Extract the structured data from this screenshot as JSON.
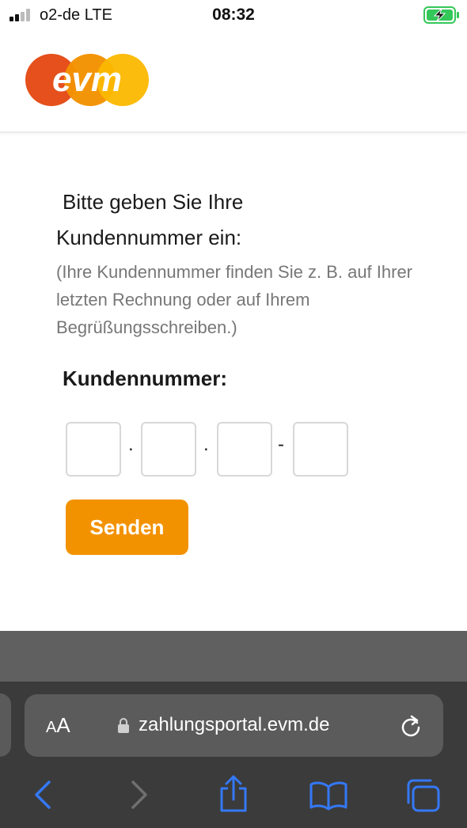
{
  "status_bar": {
    "carrier": "o2-de  LTE",
    "time": "08:32",
    "signal_bars_active": 2,
    "signal_bars_total": 4,
    "battery_color": "#34c759"
  },
  "header": {
    "logo_text": "evm",
    "logo_colors": [
      "#e5501c",
      "#f39200",
      "#fbb800"
    ]
  },
  "content": {
    "intro_line1": "Bitte geben Sie Ihre",
    "intro_line2": "Kundennummer ein:",
    "hint": "(Ihre Kundennummer finden Sie z. B. auf Ihrer letzten Rechnung oder auf Ihrem Begrüßungsschreiben.)",
    "field_label": "Kundennummer:",
    "digit_boxes": [
      "",
      "",
      "",
      ""
    ],
    "separators": [
      ".",
      ".",
      "-"
    ],
    "send_label": "Senden",
    "accent_color": "#f39200"
  },
  "browser": {
    "aa_label_small": "A",
    "aa_label_large": "A",
    "url": "zahlungsportal.evm.de",
    "toolbar_icons": [
      "back-icon",
      "forward-icon",
      "share-icon",
      "bookmarks-icon",
      "tabs-icon"
    ],
    "toolbar_icon_color": "#3478f6"
  }
}
